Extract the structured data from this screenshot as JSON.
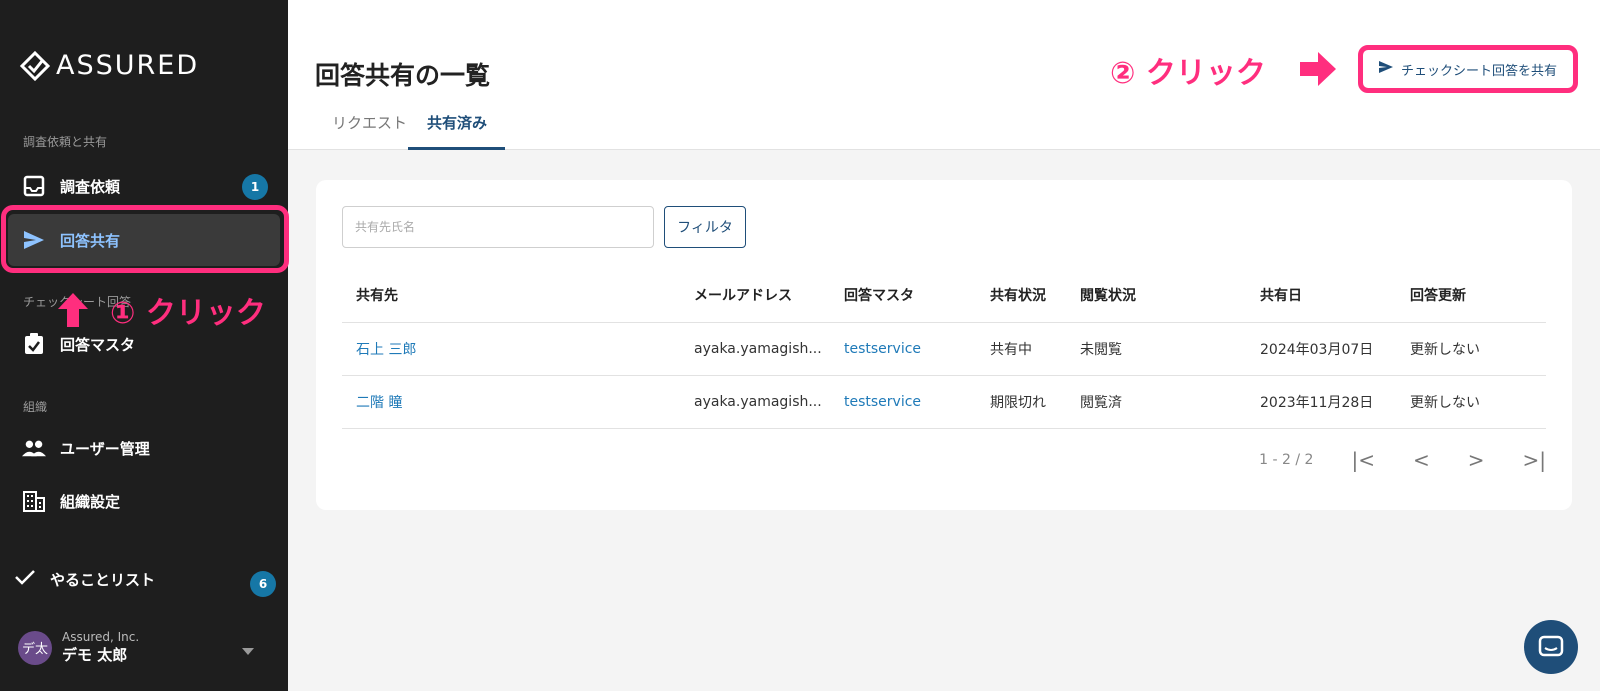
{
  "sidebar": {
    "logo": "ASSURED",
    "section_request": "調査依頼と共有",
    "items": [
      {
        "label": "調査依頼",
        "badge": "1"
      },
      {
        "label": "回答共有"
      },
      {
        "label": "回答マスタ"
      }
    ],
    "section_check": "チェックシート回答",
    "section_org": "組織",
    "org_items": [
      {
        "label": "ユーザー管理"
      },
      {
        "label": "組織設定"
      }
    ],
    "todo": {
      "label": "やることリスト",
      "badge": "6"
    },
    "user": {
      "initials": "デ太",
      "org": "Assured, Inc.",
      "name": "デモ 太郎"
    }
  },
  "annotations": {
    "step1": "① クリック",
    "step2": "② クリック"
  },
  "header": {
    "title": "回答共有の一覧",
    "tabs": [
      {
        "label": "リクエスト"
      },
      {
        "label": "共有済み"
      }
    ],
    "share_button": "チェックシート回答を共有"
  },
  "filters": {
    "search_placeholder": "共有先氏名",
    "filter_label": "フィルタ"
  },
  "table": {
    "columns": [
      "共有先",
      "メールアドレス",
      "回答マスタ",
      "共有状況",
      "閲覧状況",
      "共有日",
      "回答更新"
    ],
    "rows": [
      [
        "石上 三郎",
        "ayaka.yamagish...",
        "testservice",
        "共有中",
        "未閲覧",
        "2024年03月07日",
        "更新しない"
      ],
      [
        "二階 瞳",
        "ayaka.yamagish...",
        "testservice",
        "期限切れ",
        "閲覧済",
        "2023年11月28日",
        "更新しない"
      ]
    ]
  },
  "pagination": {
    "range": "1 - 2 / 2"
  },
  "colors": {
    "accent": "#1f4e79",
    "annotation": "#ff2e7e",
    "sidebar_bg": "#1e1e1e"
  }
}
